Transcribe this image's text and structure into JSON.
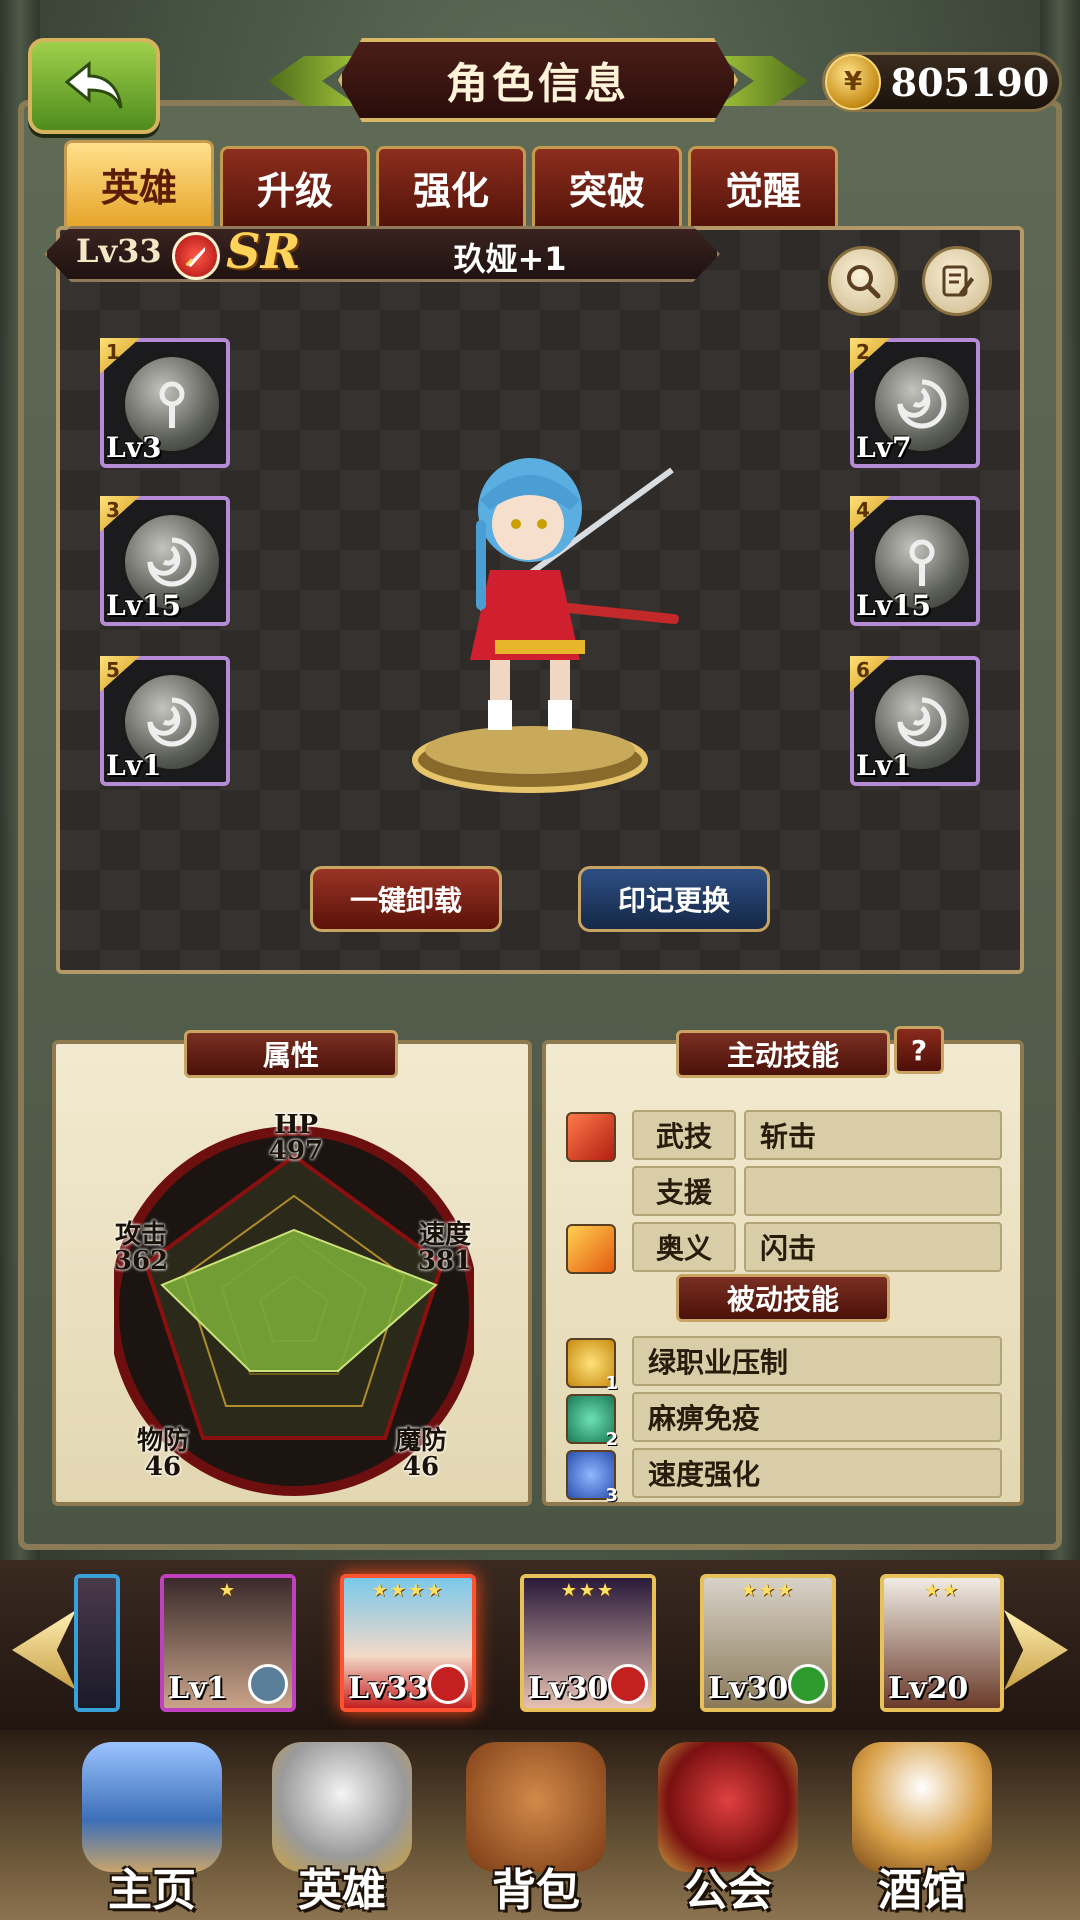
{
  "header": {
    "title": "角色信息",
    "coins": "805190"
  },
  "tabs": [
    {
      "label": "英雄",
      "active": true
    },
    {
      "label": "升级",
      "active": false
    },
    {
      "label": "强化",
      "active": false
    },
    {
      "label": "突破",
      "active": false
    },
    {
      "label": "觉醒",
      "active": false
    }
  ],
  "hero": {
    "level": "Lv33",
    "rarity": "SR",
    "name": "玖娅+1",
    "class_icon": "sword-icon"
  },
  "slots": [
    {
      "num": "1",
      "level": "Lv3"
    },
    {
      "num": "2",
      "level": "Lv7"
    },
    {
      "num": "3",
      "level": "Lv15"
    },
    {
      "num": "4",
      "level": "Lv15"
    },
    {
      "num": "5",
      "level": "Lv1"
    },
    {
      "num": "6",
      "level": "Lv1"
    }
  ],
  "actions": {
    "unequip_all": "一键卸载",
    "swap_seal": "印记更换"
  },
  "attributes": {
    "title": "属性",
    "hp": {
      "label": "HP",
      "value": "497"
    },
    "speed": {
      "label": "速度",
      "value": "381"
    },
    "mdef": {
      "label": "魔防",
      "value": "46"
    },
    "pdef": {
      "label": "物防",
      "value": "46"
    },
    "atk": {
      "label": "攻击",
      "value": "362"
    }
  },
  "skills": {
    "active_title": "主动技能",
    "help": "?",
    "active": [
      {
        "type": "武技",
        "name": "斩击",
        "icon": "sword-skill-icon"
      },
      {
        "type": "支援",
        "name": "",
        "icon": ""
      },
      {
        "type": "奥义",
        "name": "闪击",
        "icon": "flash-skill-icon"
      }
    ],
    "passive_title": "被动技能",
    "passive": [
      {
        "num": "1",
        "name": "绿职业压制",
        "color": "#e6b422"
      },
      {
        "num": "2",
        "name": "麻痹免疫",
        "color": "#2aa37a"
      },
      {
        "num": "3",
        "name": "速度强化",
        "color": "#3a6fd6"
      }
    ]
  },
  "roster": [
    {
      "level": "Lv1",
      "stars": "★",
      "badge_color": "#5a7f9a"
    },
    {
      "level": "Lv33",
      "stars": "★★★★",
      "badge_color": "#c42020"
    },
    {
      "level": "Lv30",
      "stars": "★★★",
      "badge_color": "#c42020"
    },
    {
      "level": "Lv30",
      "stars": "★★★",
      "badge_color": "#2f9b2f"
    },
    {
      "level": "Lv20",
      "stars": "★★",
      "badge_color": "#5a7f9a"
    }
  ],
  "nav": [
    {
      "label": "主页"
    },
    {
      "label": "英雄"
    },
    {
      "label": "背包"
    },
    {
      "label": "公会"
    },
    {
      "label": "酒馆"
    }
  ],
  "colors": {
    "accent_gold": "#e7a52a",
    "tab_red": "#8d2e1e",
    "radar_fill": "#7fb13a"
  }
}
